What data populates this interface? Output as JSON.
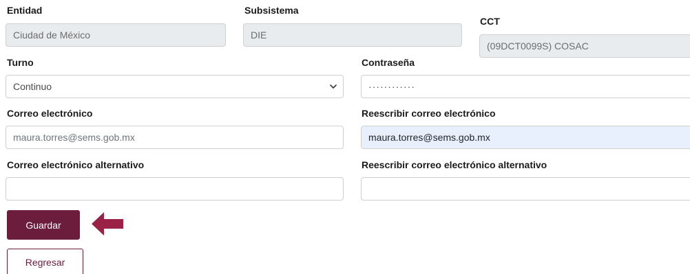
{
  "colors": {
    "brand": "#6b1d3b",
    "arrow": "#9b2247",
    "disabled_bg": "#e9ecef",
    "autofill_bg": "#e8f0fe"
  },
  "form": {
    "entidad": {
      "label": "Entidad",
      "value": "Ciudad de México"
    },
    "subsistema": {
      "label": "Subsistema",
      "value": "DIE"
    },
    "cct": {
      "label": "CCT",
      "value": "(09DCT0099S) COSAC"
    },
    "turno": {
      "label": "Turno",
      "selected": "Continuo",
      "icon": "chevron-down-icon"
    },
    "contrasena": {
      "label": "Contraseña",
      "masked_value": "············"
    },
    "correo": {
      "label": "Correo electrónico",
      "placeholder": "maura.torres@sems.gob.mx"
    },
    "correo_confirm": {
      "label": "Reescribir correo electrónico",
      "value": "maura.torres@sems.gob.mx"
    },
    "correo_alt": {
      "label": "Correo electrónico alternativo",
      "value": ""
    },
    "correo_alt_confirm": {
      "label": "Reescribir correo electrónico alternativo",
      "value": ""
    }
  },
  "actions": {
    "guardar_label": "Guardar",
    "regresar_label": "Regresar",
    "pointer_icon": "arrow-left-icon"
  }
}
